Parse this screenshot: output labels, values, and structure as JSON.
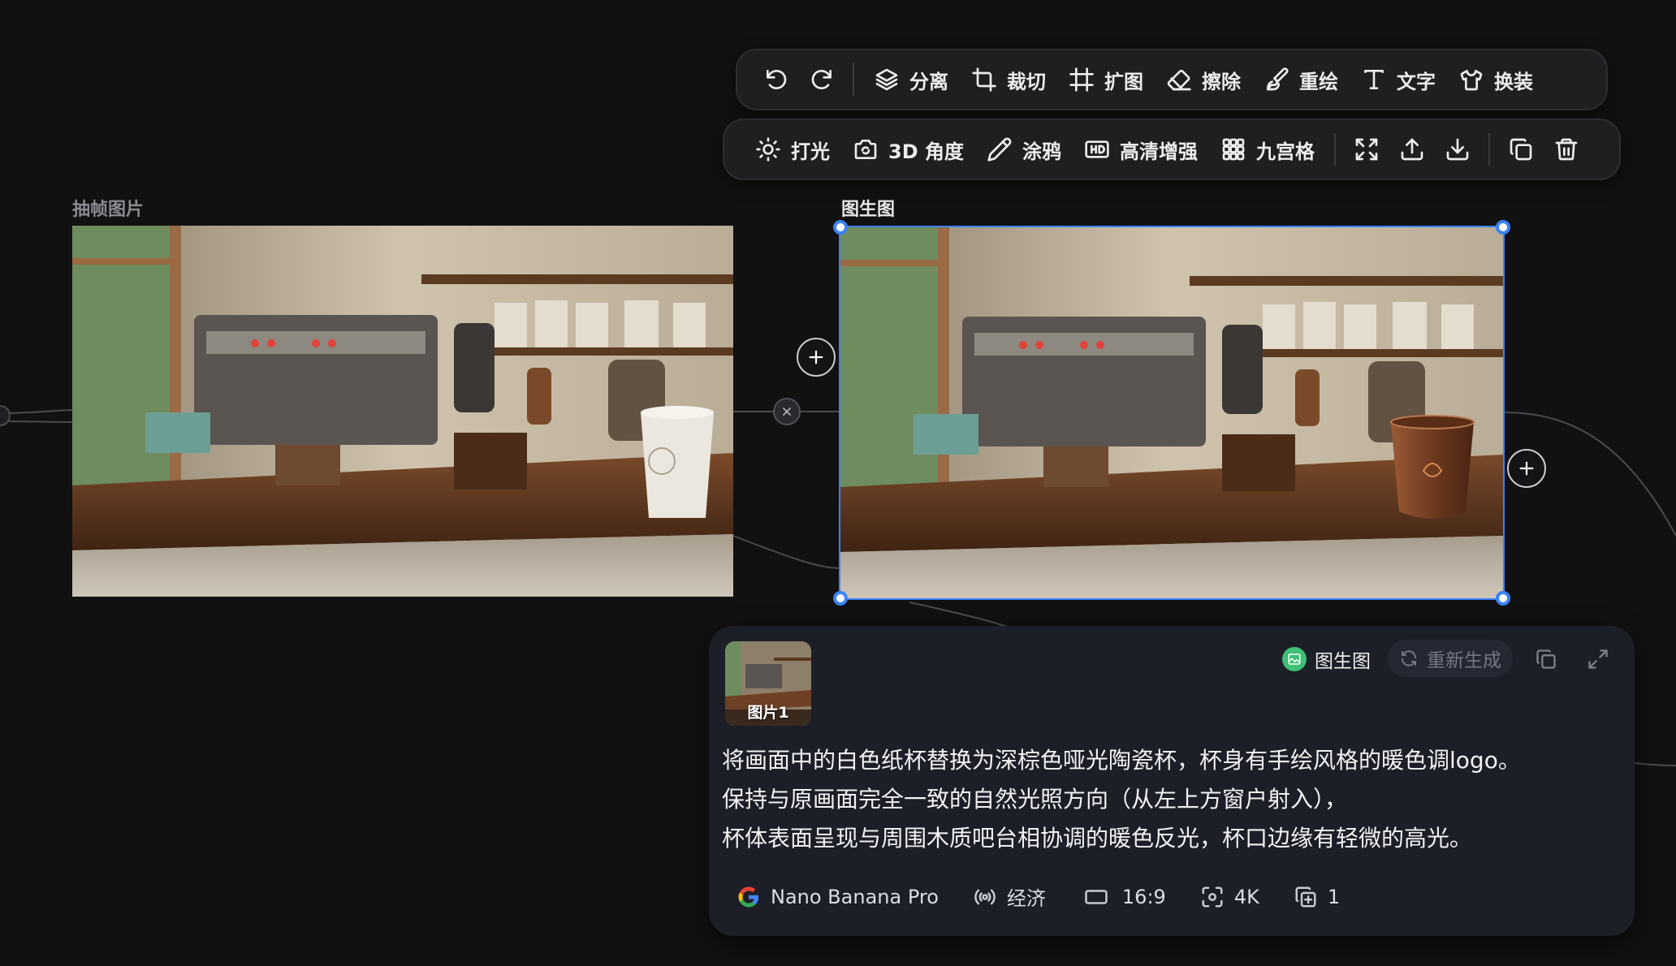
{
  "toolbar_top": {
    "separate": "分离",
    "crop": "裁切",
    "expand": "扩图",
    "erase": "擦除",
    "repaint": "重绘",
    "text": "文字",
    "outfit": "换装"
  },
  "toolbar_bottom": {
    "lighting": "打光",
    "angle_3d": "3D 角度",
    "doodle": "涂鸦",
    "hd_enhance": "高清增强",
    "nine_grid": "九宫格"
  },
  "nodes": {
    "left_label": "抽帧图片",
    "right_label": "图生图"
  },
  "panel": {
    "thumb_label": "图片1",
    "mode": "图生图",
    "regenerate": "重新生成",
    "prompt_lines": [
      "将画面中的白色纸杯替换为深棕色哑光陶瓷杯，杯身有手绘风格的暖色调logo。",
      "保持与原画面完全一致的自然光照方向（从左上方窗户射入），",
      "杯体表面呈现与周围木质吧台相协调的暖色反光，杯口边缘有轻微的高光。"
    ],
    "params": {
      "model": "Nano Banana Pro",
      "mode": "经济",
      "ratio": "16:9",
      "resolution": "4K",
      "count": "1"
    }
  },
  "colors": {
    "background": "#111111",
    "selection": "#3b82f6",
    "panel": "#1c1f27",
    "badge_green": "#3fbf74"
  }
}
